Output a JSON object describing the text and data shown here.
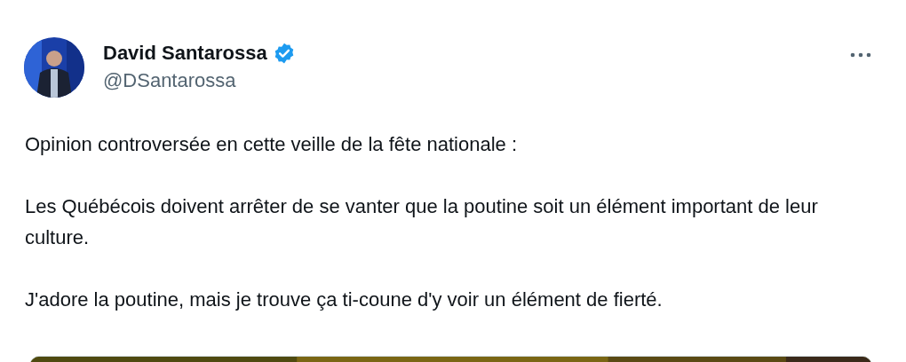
{
  "author": {
    "name": "David Santarossa",
    "verified": true,
    "handle": "@DSantarossa"
  },
  "paragraphs": [
    "Opinion controversée en cette veille de la fête nationale :",
    "Les Québécois doivent arrêter de se vanter que la poutine soit un élément important de leur culture.",
    "J'adore la poutine, mais je trouve ça ti-coune d'y voir un élément de fierté."
  ]
}
